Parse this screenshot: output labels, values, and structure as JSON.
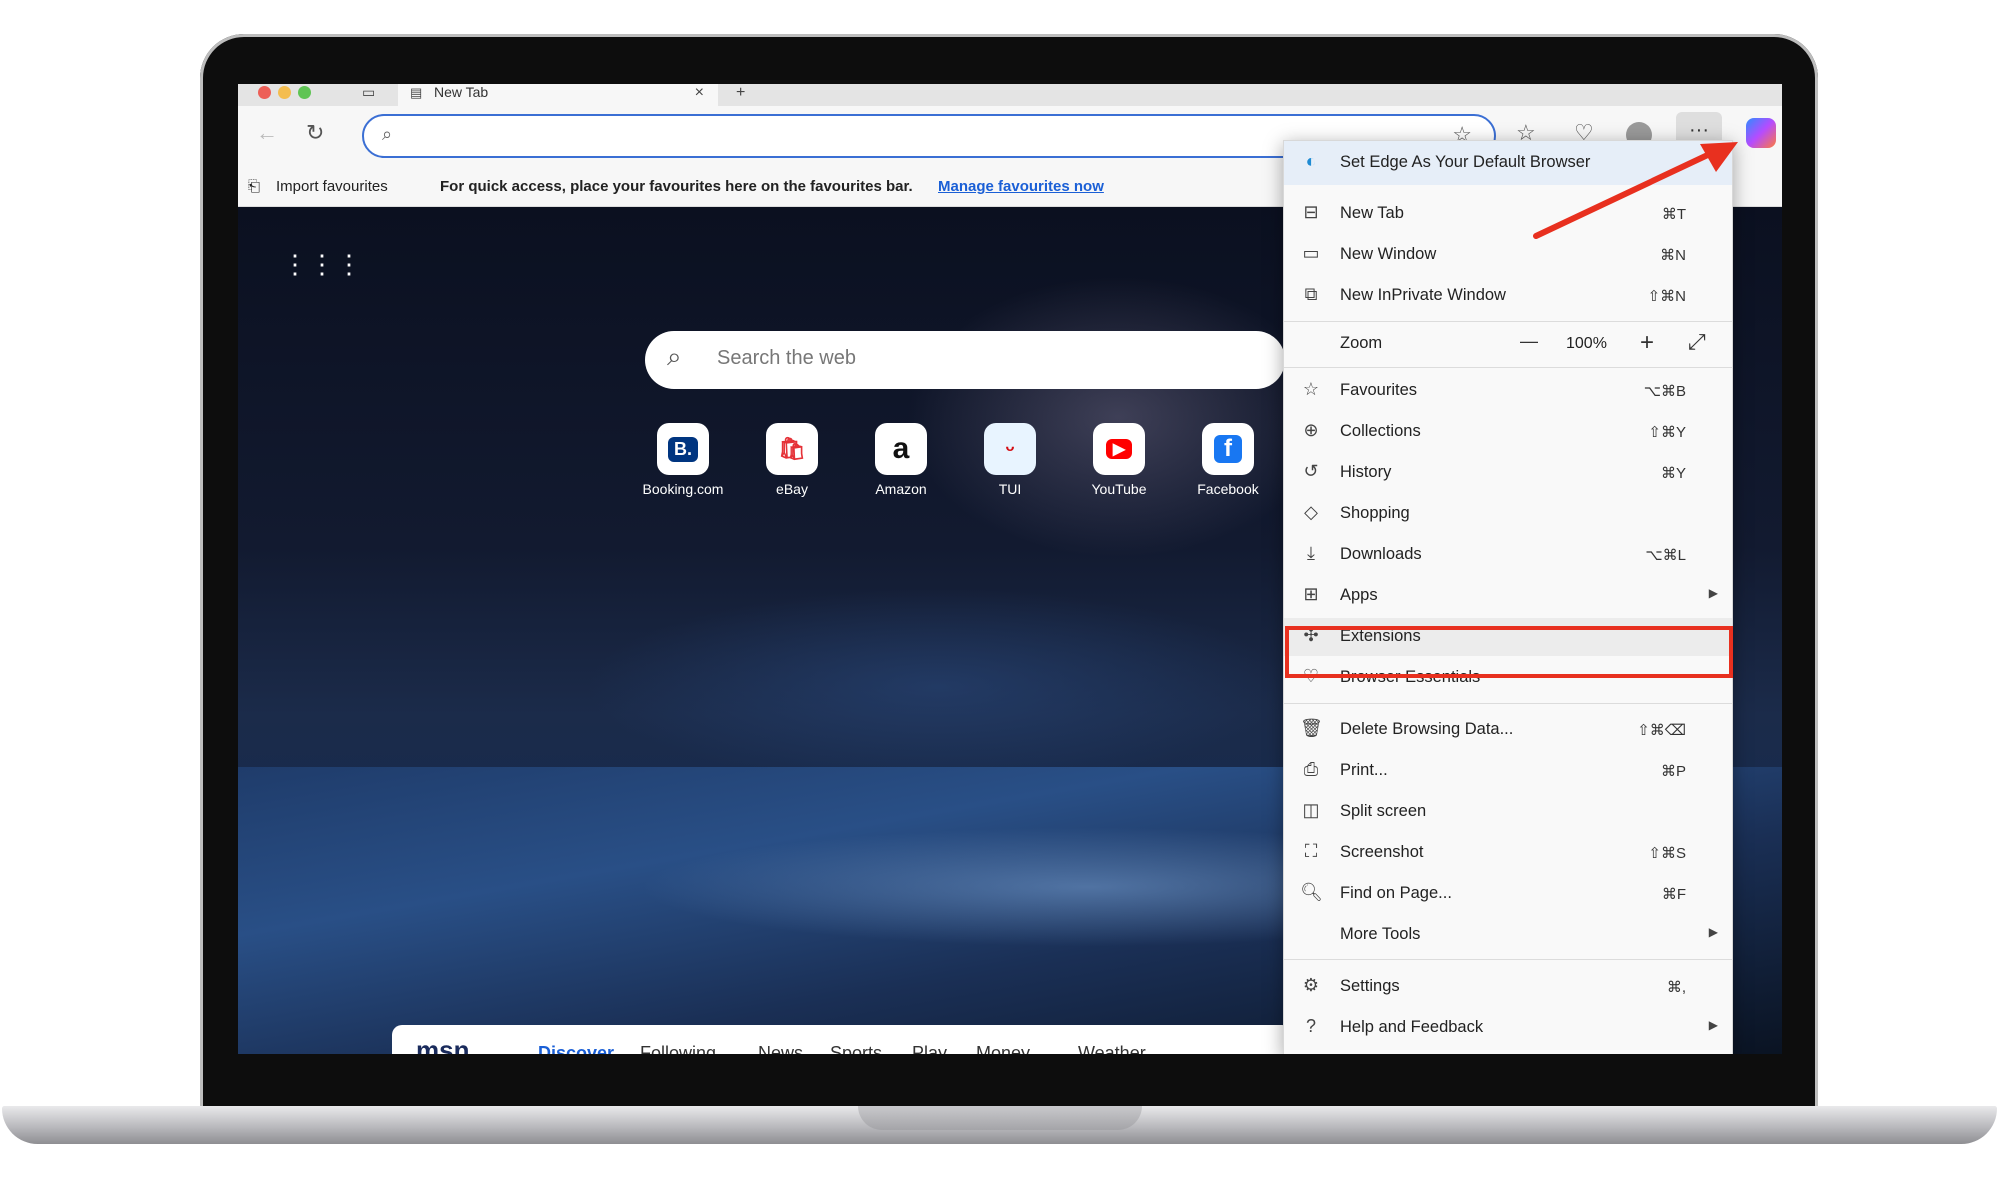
{
  "tab": {
    "title": "New Tab",
    "close": "×",
    "new": "+"
  },
  "favbar": {
    "import": "Import favourites",
    "hint": "For quick access, place your favourites here on the favourites bar.",
    "manage": "Manage favourites now"
  },
  "ntp": {
    "search_placeholder": "Search the web",
    "quick_links": [
      {
        "label": "Booking.com",
        "glyph": "B."
      },
      {
        "label": "eBay",
        "glyph": "🛍"
      },
      {
        "label": "Amazon",
        "glyph": "a"
      },
      {
        "label": "TUI",
        "glyph": "ᵕ"
      },
      {
        "label": "YouTube",
        "glyph": "▶"
      },
      {
        "label": "Facebook",
        "glyph": "f"
      }
    ],
    "msn": {
      "logo": "msn",
      "tabs": [
        "Discover",
        "Following",
        "News",
        "Sports",
        "Play",
        "Money",
        "Weather",
        "..."
      ]
    }
  },
  "menu": {
    "default_browser": "Set Edge As Your Default Browser",
    "items": [
      {
        "label": "New Tab",
        "shortcut": "⌘T",
        "icon": "new-tab-icon"
      },
      {
        "label": "New Window",
        "shortcut": "⌘N",
        "icon": "new-window-icon"
      },
      {
        "label": "New InPrivate Window",
        "shortcut": "⇧⌘N",
        "icon": "inprivate-icon"
      },
      {
        "label": "Favourites",
        "shortcut": "⌥⌘B",
        "icon": "favourites-icon"
      },
      {
        "label": "Collections",
        "shortcut": "⇧⌘Y",
        "icon": "collections-icon"
      },
      {
        "label": "History",
        "shortcut": "⌘Y",
        "icon": "history-icon"
      },
      {
        "label": "Shopping",
        "shortcut": "",
        "icon": "shopping-icon"
      },
      {
        "label": "Downloads",
        "shortcut": "⌥⌘L",
        "icon": "downloads-icon"
      },
      {
        "label": "Apps",
        "shortcut": "",
        "icon": "apps-icon"
      },
      {
        "label": "Extensions",
        "shortcut": "",
        "icon": "extensions-icon"
      },
      {
        "label": "Browser Essentials",
        "shortcut": "",
        "icon": "browser-essentials-icon"
      },
      {
        "label": "Delete Browsing Data...",
        "shortcut": "⇧⌘⌫",
        "icon": "delete-icon"
      },
      {
        "label": "Print...",
        "shortcut": "⌘P",
        "icon": "print-icon"
      },
      {
        "label": "Split screen",
        "shortcut": "",
        "icon": "split-screen-icon"
      },
      {
        "label": "Screenshot",
        "shortcut": "⇧⌘S",
        "icon": "screenshot-icon"
      },
      {
        "label": "Find on Page...",
        "shortcut": "⌘F",
        "icon": "find-icon"
      },
      {
        "label": "More Tools",
        "shortcut": "",
        "icon": ""
      },
      {
        "label": "Settings",
        "shortcut": "⌘,",
        "icon": "settings-icon"
      },
      {
        "label": "Help and Feedback",
        "shortcut": "",
        "icon": "help-icon"
      }
    ],
    "zoom": {
      "label": "Zoom",
      "minus": "—",
      "value": "100%",
      "plus": "+",
      "fullscreen": "⤢"
    }
  },
  "colors": {
    "highlight": "#e8301f",
    "accent": "#1a5fd6"
  }
}
